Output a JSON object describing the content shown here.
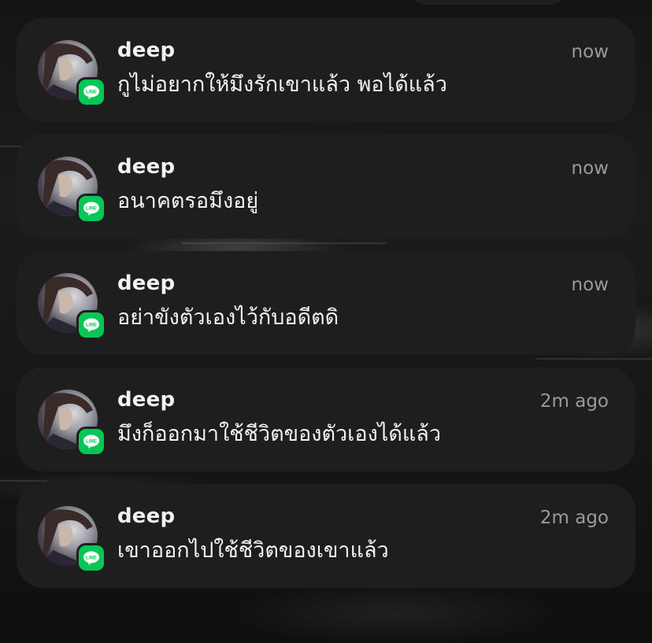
{
  "notifications": [
    {
      "sender": "deep",
      "time": "now",
      "message": "กูไม่อยากให้มึงรักเขาแล้ว พอได้แล้ว",
      "app_icon": "line-icon"
    },
    {
      "sender": "deep",
      "time": "now",
      "message": "อนาคตรอมึงอยู่",
      "app_icon": "line-icon"
    },
    {
      "sender": "deep",
      "time": "now",
      "message": "อย่าขังตัวเองไว้กับอดีตดิ",
      "app_icon": "line-icon"
    },
    {
      "sender": "deep",
      "time": "2m ago",
      "message": "มึงก็ออกมาใช้ชีวิตของตัวเองได้แล้ว",
      "app_icon": "line-icon"
    },
    {
      "sender": "deep",
      "time": "2m ago",
      "message": "เขาออกไปใช้ชีวิตของเขาแล้ว",
      "app_icon": "line-icon"
    }
  ],
  "badge_label": "LINE",
  "colors": {
    "card_background": "#1e1e1e",
    "line_green": "#06c755",
    "primary_text": "#f2f2f2",
    "secondary_text": "#9a9a9a"
  }
}
